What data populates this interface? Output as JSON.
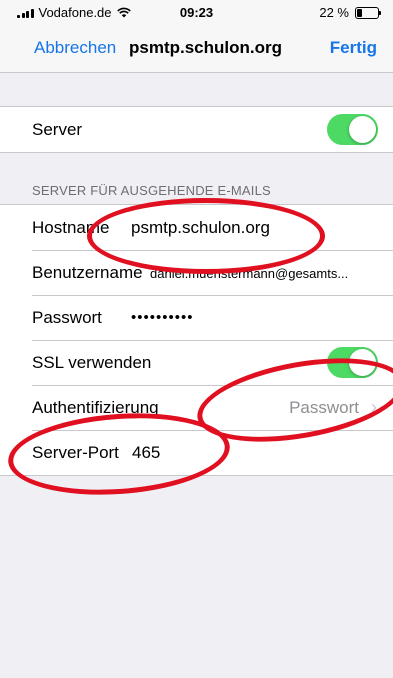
{
  "status_bar": {
    "carrier": "Vodafone.de",
    "time": "09:23",
    "battery": "22 %",
    "battery_level": 0.22
  },
  "nav": {
    "cancel_label": "Abbrechen",
    "title": "psmtp.schulon.org",
    "done_label": "Fertig"
  },
  "server_row": {
    "label": "Server",
    "enabled": true
  },
  "outgoing_section": {
    "header": "SERVER FÜR AUSGEHENDE E-MAILS",
    "hostname_label": "Hostname",
    "hostname_value": "psmtp.schulon.org",
    "username_label": "Benutzername",
    "username_value": "daniel.muenstermann@gesamts...",
    "password_label": "Passwort",
    "password_value": "••••••••••",
    "ssl_label": "SSL verwenden",
    "ssl_enabled": true,
    "auth_label": "Authentifizierung",
    "auth_value": "Passwort",
    "port_label": "Server-Port",
    "port_value": "465"
  },
  "colors": {
    "accent": "#1675e8",
    "toggle_on": "#4cd964",
    "annotation": "#e01020",
    "background": "#efeff4"
  }
}
